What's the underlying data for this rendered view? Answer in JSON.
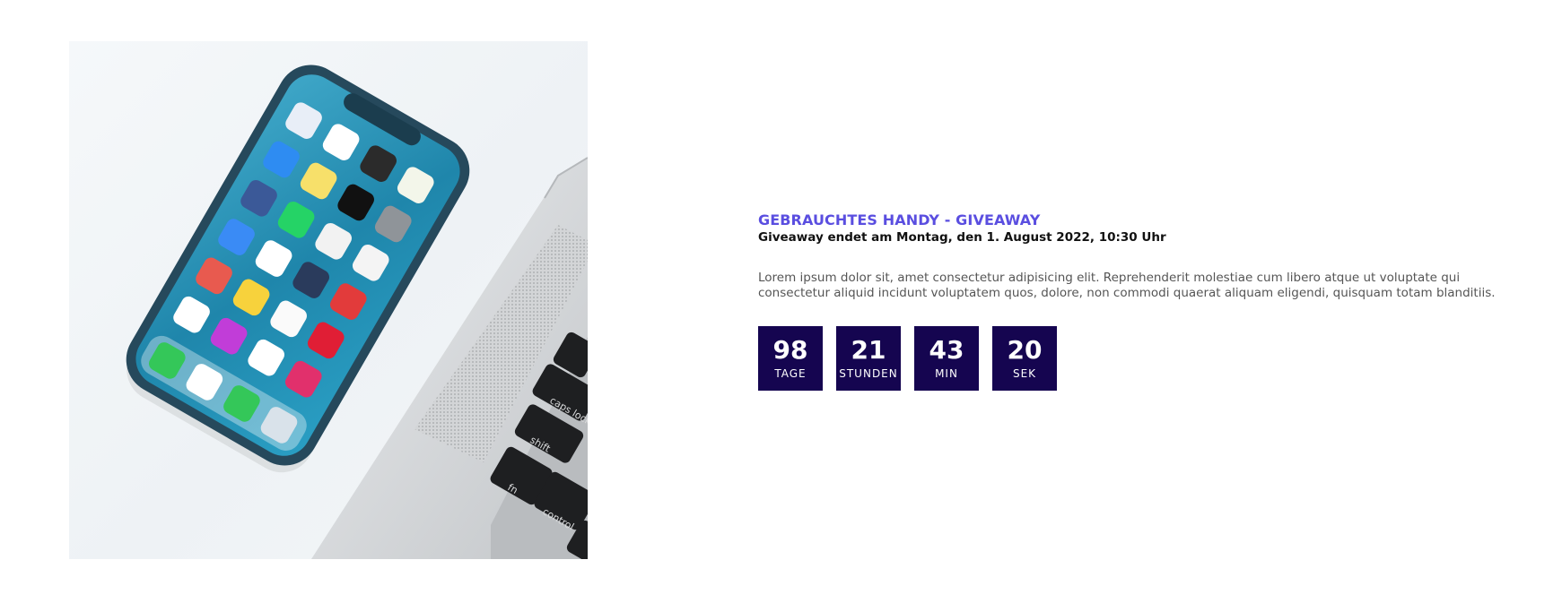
{
  "hero_image": {
    "alt": "Smartphone neben Laptop"
  },
  "giveaway": {
    "title": "GEBRAUCHTES HANDY - GIVEAWAY",
    "end_text": "Giveaway endet am Montag, den 1. August 2022, 10:30 Uhr",
    "description": "Lorem ipsum dolor sit, amet consectetur adipisicing elit. Reprehenderit molestiae cum libero atque ut voluptate qui consectetur aliquid incidunt voluptatem quos, dolore, non commodi quaerat aliquam eligendi, quisquam totam blanditiis."
  },
  "countdown": {
    "days": {
      "value": "98",
      "label": "TAGE"
    },
    "hours": {
      "value": "21",
      "label": "STUNDEN"
    },
    "minutes": {
      "value": "43",
      "label": "MIN"
    },
    "seconds": {
      "value": "20",
      "label": "SEK"
    }
  },
  "colors": {
    "accent": "#5a4ee0",
    "countdown_bg": "#150550",
    "text": "#111111",
    "muted_text": "#555555"
  }
}
